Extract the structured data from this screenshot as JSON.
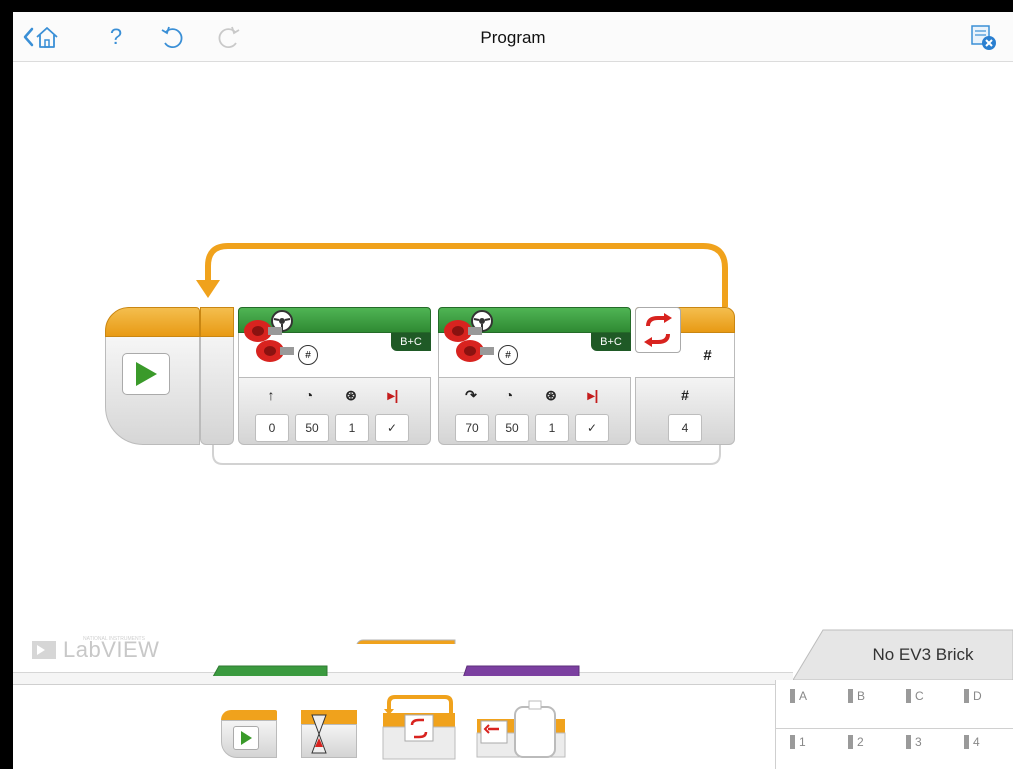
{
  "app": {
    "title": "Program"
  },
  "brand": {
    "vendor": "NATIONAL INSTRUMENTS",
    "name": "LabVIEW"
  },
  "colors": {
    "accent": "#3a8fd6",
    "flow_orange": "#f0a21c",
    "move_green": "#3b9a3f",
    "move_dark": "#1f5a26",
    "sensor_purple": "#7b3fa0",
    "motor_red": "#d8231f"
  },
  "program": {
    "start_icon": "play-icon",
    "steer1": {
      "ports": "B+C",
      "mode_icon": "rotations-icon",
      "values": [
        "0",
        "50",
        "1",
        "✓"
      ],
      "param_icons": [
        "steering-icon",
        "power-icon",
        "rotations-icon",
        "brake-icon"
      ]
    },
    "steer2": {
      "ports": "B+C",
      "mode_icon": "rotations-icon",
      "values": [
        "70",
        "50",
        "1",
        "✓"
      ],
      "param_icons": [
        "turn-icon",
        "power-icon",
        "rotations-icon",
        "brake-icon"
      ]
    },
    "loop_end": {
      "mode_symbol": "#",
      "param_symbol": "#",
      "count": "4",
      "icon": "loop-icon"
    }
  },
  "palette": {
    "tabs": [
      "action-tab",
      "flow-control-tab",
      "sensor-tab"
    ],
    "active_tab": "flow-control-tab",
    "blocks": [
      "start-block",
      "wait-block",
      "loop-block",
      "switch-block"
    ]
  },
  "brick": {
    "status": "No EV3 Brick",
    "motor_ports": [
      "A",
      "B",
      "C",
      "D"
    ],
    "sensor_ports": [
      "1",
      "2",
      "3",
      "4"
    ]
  }
}
